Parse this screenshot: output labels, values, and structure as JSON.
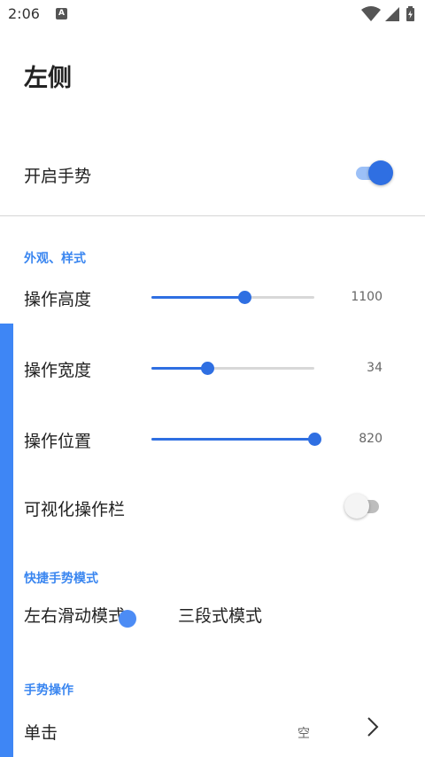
{
  "status_bar": {
    "time": "2:06",
    "notification_icon": "A",
    "icons": [
      "wifi-icon",
      "signal-icon",
      "battery-charging-icon"
    ]
  },
  "page": {
    "title": "左侧"
  },
  "master": {
    "label": "开启手势",
    "enabled": true
  },
  "sections": {
    "appearance": "外观、样式",
    "quick_mode": "快捷手势模式",
    "gesture_ops": "手势操作"
  },
  "sliders": {
    "height": {
      "label": "操作高度",
      "value": "1100",
      "fraction": 0.57
    },
    "width": {
      "label": "操作宽度",
      "value": "34",
      "fraction": 0.34
    },
    "position": {
      "label": "操作位置",
      "value": "820",
      "fraction": 1.0
    }
  },
  "visible_bar": {
    "label": "可视化操作栏",
    "enabled": false
  },
  "modes": {
    "left_right": "左右滑动模式",
    "three_stage": "三段式模式"
  },
  "gestures": {
    "tap": {
      "label": "单击",
      "value": "空"
    }
  },
  "colors": {
    "accent": "#2f6fe2",
    "edge_bar": "#3e86f5",
    "section_title": "#3a86f0"
  }
}
